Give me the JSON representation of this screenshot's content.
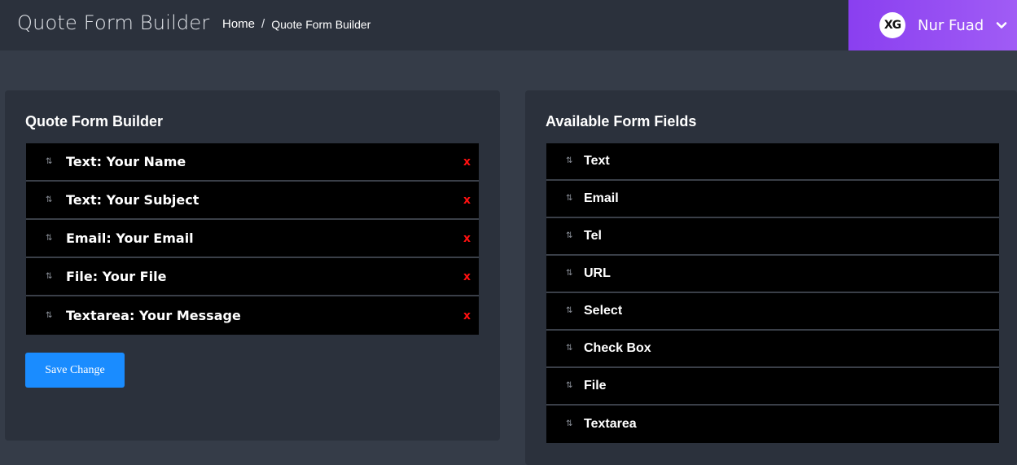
{
  "header": {
    "app_title": "Quote Form Builder",
    "breadcrumb": {
      "home": "Home",
      "separator": "/",
      "current": "Quote Form Builder"
    },
    "user": {
      "avatar_text": "XG",
      "name": "Nur Fuad",
      "icon": "chevron-down-icon"
    },
    "user_gradient": [
      "#8a3ff0",
      "#a05cf5"
    ]
  },
  "builder": {
    "title": "Quote Form Builder",
    "fields": [
      {
        "label": "Text: Your Name",
        "remove": "x"
      },
      {
        "label": "Text: Your Subject",
        "remove": "x"
      },
      {
        "label": "Email: Your Email",
        "remove": "x"
      },
      {
        "label": "File: Your File",
        "remove": "x"
      },
      {
        "label": "Textarea: Your Message",
        "remove": "x"
      }
    ],
    "save_label": "Save Change",
    "accent": "#1a8cff",
    "remove_color": "#ff1010"
  },
  "available": {
    "title": "Available Form Fields",
    "fields": [
      "Text",
      "Email",
      "Tel",
      "URL",
      "Select",
      "Check Box",
      "File",
      "Textarea"
    ]
  }
}
